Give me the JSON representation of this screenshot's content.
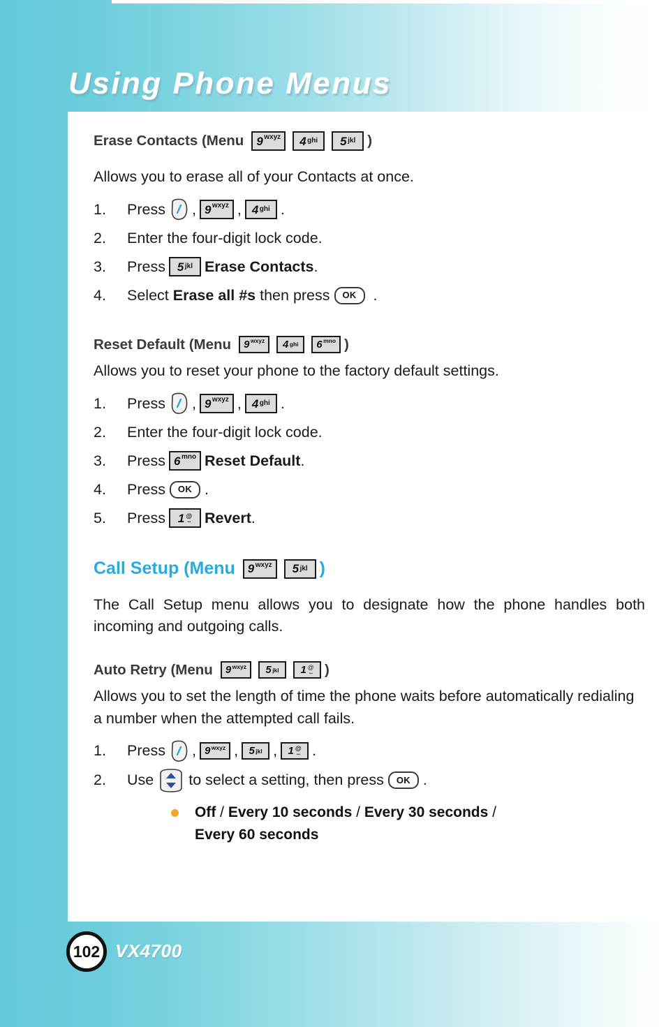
{
  "header": {
    "title": "Using Phone Menus"
  },
  "footer": {
    "page_number": "102",
    "model": "VX4700"
  },
  "colors": {
    "accent_heading": "#27ACE2",
    "bullet": "#F5A623",
    "band": "#64CADA",
    "body_text": "#1A1A1A",
    "subhead_text": "#3A3A3A"
  },
  "keys": {
    "nine": {
      "digit": "9",
      "letters": "wxyz"
    },
    "four": {
      "digit": "4",
      "letters": "ghi"
    },
    "five": {
      "digit": "5",
      "letters": "jkl"
    },
    "six": {
      "digit": "6",
      "letters": "mno"
    },
    "one": {
      "digit": "1",
      "at": "@",
      "dots": "..."
    },
    "ok": {
      "label": "OK"
    }
  },
  "sections": [
    {
      "id": "erase-contacts",
      "heading_prefix": "Erase Contacts (Menu",
      "heading_suffix": ")",
      "description": "Allows you to erase all of your Contacts at once.",
      "steps": [
        {
          "num": "1.",
          "lead": "Press",
          "tail": "."
        },
        {
          "num": "2.",
          "lead": "Enter the four-digit lock code."
        },
        {
          "num": "3.",
          "lead": "Press",
          "bold": "Erase Contacts",
          "tail": "."
        },
        {
          "num": "4.",
          "lead": "Select",
          "bold": "Erase all #s",
          "mid": "then press",
          "tail": "."
        }
      ]
    },
    {
      "id": "reset-default",
      "heading_prefix": "Reset Default (Menu",
      "heading_suffix": ")",
      "description": "Allows you to reset your phone to the factory default settings.",
      "steps": [
        {
          "num": "1.",
          "lead": "Press",
          "tail": "."
        },
        {
          "num": "2.",
          "lead": "Enter the four-digit lock code."
        },
        {
          "num": "3.",
          "lead": "Press",
          "bold": "Reset Default",
          "tail": "."
        },
        {
          "num": "4.",
          "lead": "Press",
          "tail": "."
        },
        {
          "num": "5.",
          "lead": "Press",
          "bold": "Revert",
          "tail": "."
        }
      ]
    },
    {
      "id": "call-setup",
      "heading_prefix": "Call Setup (Menu",
      "heading_suffix": ")",
      "description": "The Call Setup menu allows you to designate how the phone handles both incoming and outgoing calls."
    },
    {
      "id": "auto-retry",
      "heading_prefix": "Auto Retry (Menu",
      "heading_suffix": ")",
      "description": "Allows you to set the length of time the phone waits before automatically redialing a number when the attempted call fails.",
      "steps": [
        {
          "num": "1.",
          "lead": "Press",
          "tail": "."
        },
        {
          "num": "2.",
          "lead": "Use",
          "mid": "to select a setting, then press",
          "tail": "."
        }
      ],
      "options": {
        "line1_a": "Off",
        "sep1": "/",
        "line1_b": "Every 10 seconds",
        "sep2": "/",
        "line1_c": "Every 30 seconds",
        "sep3": "/",
        "line2": "Every 60 seconds"
      }
    }
  ]
}
